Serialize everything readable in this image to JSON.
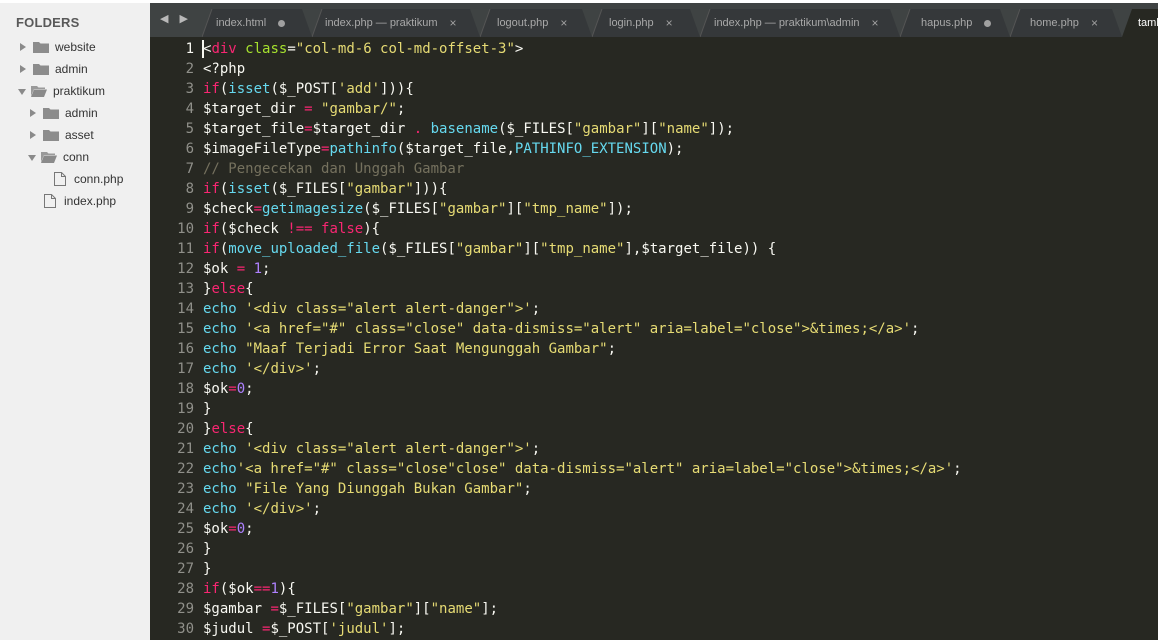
{
  "sidebar": {
    "title": "FOLDERS",
    "items": [
      {
        "label": "website",
        "type": "folder",
        "expanded": false,
        "depth": 0
      },
      {
        "label": "admin",
        "type": "folder",
        "expanded": false,
        "depth": 0
      },
      {
        "label": "praktikum",
        "type": "folder",
        "expanded": true,
        "depth": 0
      },
      {
        "label": "admin",
        "type": "folder",
        "expanded": false,
        "depth": 1
      },
      {
        "label": "asset",
        "type": "folder",
        "expanded": false,
        "depth": 1
      },
      {
        "label": "conn",
        "type": "folder",
        "expanded": true,
        "depth": 1
      },
      {
        "label": "conn.php",
        "type": "file",
        "depth": 2
      },
      {
        "label": "index.php",
        "type": "file",
        "depth": 1
      }
    ]
  },
  "tabs": {
    "nav": "◀ ▶",
    "items": [
      {
        "label": "index.html",
        "marker": "dot"
      },
      {
        "label": "index.php — praktikum",
        "marker": "close"
      },
      {
        "label": "logout.php",
        "marker": "close"
      },
      {
        "label": "login.php",
        "marker": "close"
      },
      {
        "label": "index.php — praktikum\\admin",
        "marker": "close"
      },
      {
        "label": "hapus.php",
        "marker": "dot"
      },
      {
        "label": "home.php",
        "marker": "close"
      },
      {
        "label": "tamb",
        "marker": "none",
        "active": true
      }
    ],
    "close_glyph": "×"
  },
  "editor": {
    "lines": [
      "<div class=\"col-md-6 col-md-offset-3\">",
      "<?php",
      "if(isset($_POST['add'])){",
      "$target_dir = \"gambar/\";",
      "$target_file=$target_dir . basename($_FILES[\"gambar\"][\"name\"]);",
      "$imageFileType=pathinfo($target_file,PATHINFO_EXTENSION);",
      "// Pengecekan dan Unggah Gambar",
      "if(isset($_FILES[\"gambar\"])){",
      "$check=getimagesize($_FILES[\"gambar\"][\"tmp_name\"]);",
      "if($check !== false){",
      "if(move_uploaded_file($_FILES[\"gambar\"][\"tmp_name\"],$target_file)) {",
      "$ok = 1;",
      "}else{",
      "echo '<div class=\"alert alert-danger\">';",
      "echo '<a href=\"#\" class=\"close\" data-dismiss=\"alert\" aria=label=\"close\">&times;</a>';",
      "echo \"Maaf Terjadi Error Saat Mengunggah Gambar\";",
      "echo '</div>';",
      "$ok=0;",
      "}",
      "}else{",
      "echo '<div class=\"alert alert-danger\">';",
      "echo'<a href=\"#\" class=\"close\"close\" data-dismiss=\"alert\" aria=label=\"close\">&times;</a>';",
      "echo \"File Yang Diunggah Bukan Gambar\";",
      "echo '</div>';",
      "$ok=0;",
      "}",
      "}",
      "if($ok==1){",
      "$gambar =$_FILES[\"gambar\"][\"name\"];",
      "$judul =$_POST['judul'];"
    ]
  },
  "colors": {
    "editor_bg": "#272822",
    "keyword": "#f92672",
    "function": "#66d9ef",
    "string": "#e6db74",
    "number": "#ae81ff",
    "comment": "#75715e"
  }
}
